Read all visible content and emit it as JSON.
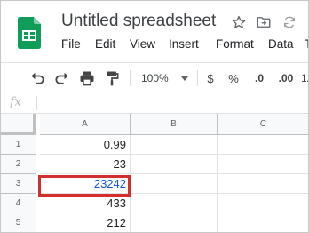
{
  "app": {
    "title": "Untitled spreadsheet",
    "brand_color": "#0f9d58"
  },
  "header_icons": [
    "star-icon",
    "move-to-folder-icon",
    "sync-status-icon"
  ],
  "menu": {
    "items": [
      "File",
      "Edit",
      "View",
      "Insert",
      "Format",
      "Data",
      "T"
    ]
  },
  "toolbar": {
    "undo_icon": "undo-icon",
    "redo_icon": "redo-icon",
    "print_icon": "print-icon",
    "paint_format_icon": "paint-format-icon",
    "zoom": "100%",
    "currency": "$",
    "percent": "%",
    "decrease_decimal": ".0",
    "increase_decimal": ".00",
    "more_formats": "12"
  },
  "formula_bar": {
    "label": "fx",
    "value": ""
  },
  "sheet": {
    "columns": [
      "A",
      "B",
      "C"
    ],
    "rows": [
      {
        "num": "1",
        "a": "0.99",
        "link": false
      },
      {
        "num": "2",
        "a": "23",
        "link": false
      },
      {
        "num": "3",
        "a": "23242",
        "link": true
      },
      {
        "num": "4",
        "a": "433",
        "link": false
      },
      {
        "num": "5",
        "a": "212",
        "link": false
      }
    ],
    "highlight_color": "#d32f2f",
    "link_color": "#1155cc"
  }
}
